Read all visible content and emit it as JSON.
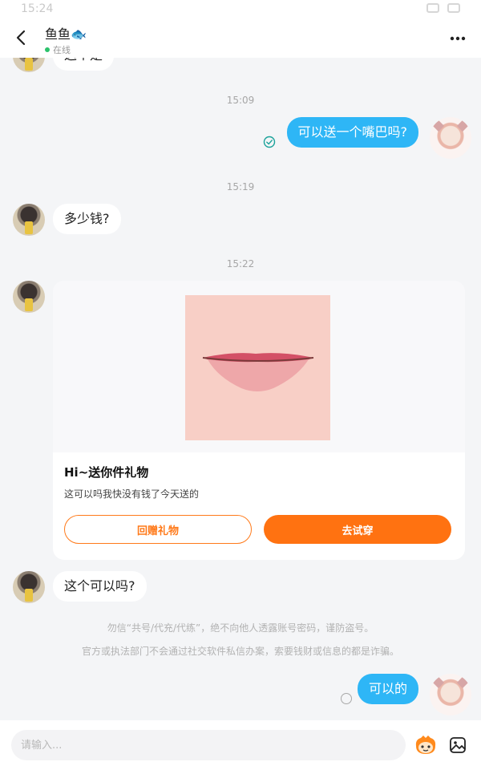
{
  "status_bar": {
    "time": "15:24"
  },
  "header": {
    "contact_name": "鱼鱼🐟",
    "online_status": "在线"
  },
  "messages": [
    {
      "from": "other",
      "text": "这个是"
    },
    {
      "timestamp": "15:09"
    },
    {
      "from": "self",
      "text": "可以送一个嘴巴吗?",
      "status": "read"
    },
    {
      "timestamp": "15:19"
    },
    {
      "from": "other",
      "text": "多少钱?"
    },
    {
      "timestamp": "15:22"
    },
    {
      "from": "other",
      "type": "gift_card"
    },
    {
      "from": "other",
      "text": "这个可以吗?"
    },
    {
      "from": "self",
      "text": "可以的",
      "status": "unread"
    }
  ],
  "gift_card": {
    "title": "Hi~送你件礼物",
    "description": "这可以吗我快没有钱了今天送的",
    "return_gift_label": "回赠礼物",
    "try_on_label": "去试穿"
  },
  "notices": {
    "line1": "勿信“共号/代充/代练”，绝不向他人透露账号密码，谨防盗号。",
    "line2": "官方或执法部门不会通过社交软件私信办案，索要钱财或信息的都是诈骗。"
  },
  "input": {
    "placeholder": "请输入..."
  },
  "colors": {
    "self_bubble": "#2eb6f6",
    "accent_orange": "#ff7211",
    "online_dot": "#2bc26b"
  },
  "icons": [
    "back-icon",
    "more-icon",
    "read-check-icon",
    "emoji-icon",
    "image-icon"
  ]
}
